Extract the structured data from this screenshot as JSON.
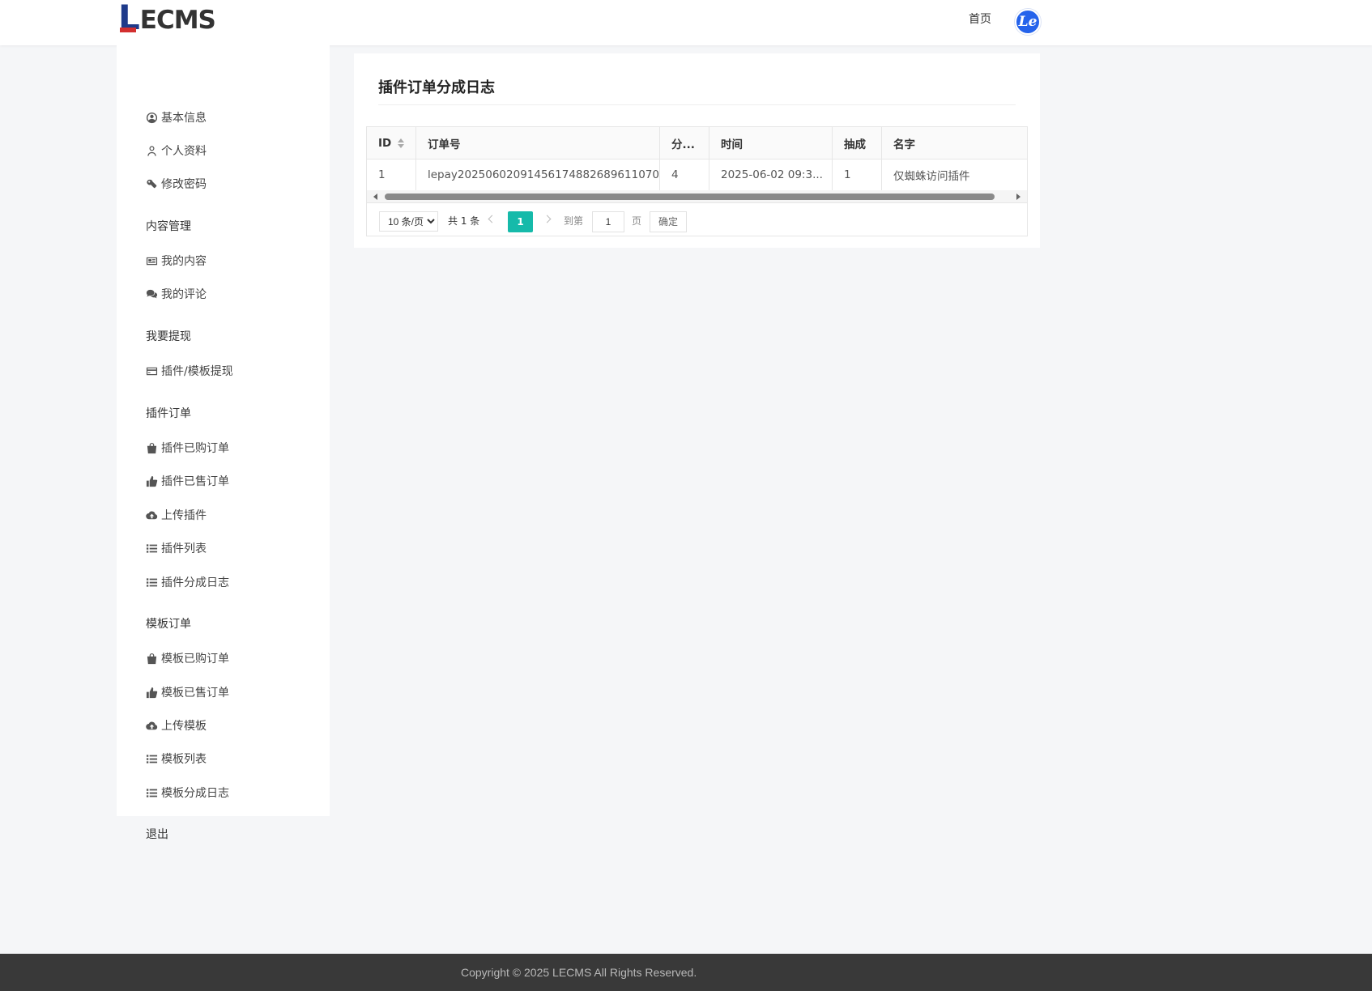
{
  "header": {
    "logo_initial": "L",
    "logo_rest": "ECMS",
    "nav_home": "首页",
    "avatar_text": "Le"
  },
  "sidebar": {
    "account_items": [
      {
        "label": "基本信息",
        "icon": "user-circle-icon"
      },
      {
        "label": "个人资料",
        "icon": "user-icon"
      },
      {
        "label": "修改密码",
        "icon": "key-icon"
      }
    ],
    "sections": [
      {
        "title": "内容管理",
        "items": [
          {
            "label": "我的内容",
            "icon": "newspaper-icon"
          },
          {
            "label": "我的评论",
            "icon": "comments-icon"
          }
        ]
      },
      {
        "title": "我要提现",
        "items": [
          {
            "label": "插件/模板提现",
            "icon": "credit-card-icon"
          }
        ]
      },
      {
        "title": "插件订单",
        "items": [
          {
            "label": "插件已购订单",
            "icon": "shopping-bag-icon"
          },
          {
            "label": "插件已售订单",
            "icon": "thumbs-up-icon"
          },
          {
            "label": "上传插件",
            "icon": "cloud-upload-icon"
          },
          {
            "label": "插件列表",
            "icon": "list-icon"
          },
          {
            "label": "插件分成日志",
            "icon": "list-icon"
          }
        ]
      },
      {
        "title": "模板订单",
        "items": [
          {
            "label": "模板已购订单",
            "icon": "shopping-bag-icon"
          },
          {
            "label": "模板已售订单",
            "icon": "thumbs-up-icon"
          },
          {
            "label": "上传模板",
            "icon": "cloud-upload-icon"
          },
          {
            "label": "模板列表",
            "icon": "list-icon"
          },
          {
            "label": "模板分成日志",
            "icon": "list-icon"
          }
        ]
      }
    ],
    "logout": "退出"
  },
  "main": {
    "title": "插件订单分成日志",
    "table": {
      "columns": [
        "ID",
        "订单号",
        "分...",
        "时间",
        "抽成",
        "名字"
      ],
      "rows": [
        [
          "1",
          "lepay2025060209145617488268961 1070",
          "4",
          "2025-06-02 09:3...",
          "1",
          "仅蜘蛛访问插件"
        ]
      ]
    },
    "pagination": {
      "page_size": "10 条/页",
      "total": "共 1 条",
      "current_page": "1",
      "goto_label": "到第",
      "goto_value": "1",
      "page_suffix": "页",
      "confirm": "确定"
    }
  },
  "footer": {
    "copyright": "Copyright © 2025 LECMS All Rights Reserved."
  }
}
